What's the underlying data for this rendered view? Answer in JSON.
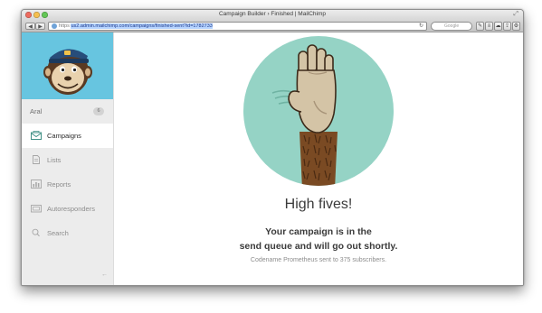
{
  "window": {
    "title": "Campaign Builder › Finished | MailChimp"
  },
  "toolbar": {
    "back_label": "◀",
    "forward_label": "▶",
    "url_protocol": "https",
    "url": "us2.admin.mailchimp.com/campaigns/finished-sent?id=1782733",
    "search_placeholder": "Google",
    "buttons": [
      "bookmark-icon",
      "reader-icon",
      "cloud-icon",
      "share-icon",
      "settings-gear-icon"
    ]
  },
  "sidebar": {
    "user": {
      "name": "Aral",
      "badge": "6"
    },
    "items": [
      {
        "label": "Campaigns",
        "icon": "envelope-icon",
        "active": true
      },
      {
        "label": "Lists",
        "icon": "document-icon",
        "active": false
      },
      {
        "label": "Reports",
        "icon": "bar-chart-icon",
        "active": false
      },
      {
        "label": "Autoresponders",
        "icon": "autoresponder-icon",
        "active": false
      },
      {
        "label": "Search",
        "icon": "search-icon",
        "active": false
      }
    ],
    "collapse_label": "←"
  },
  "main": {
    "headline": "High fives!",
    "message_line1": "Your campaign is in the",
    "message_line2": "send queue and will go out shortly.",
    "detail": "Codename Prometheus sent to 375 subscribers."
  },
  "colors": {
    "sidebar_hero": "#67c5e0",
    "illustration_circle": "#95d3c5",
    "arm_fur": "#7a4a23",
    "hand": "#d4c4a6"
  }
}
